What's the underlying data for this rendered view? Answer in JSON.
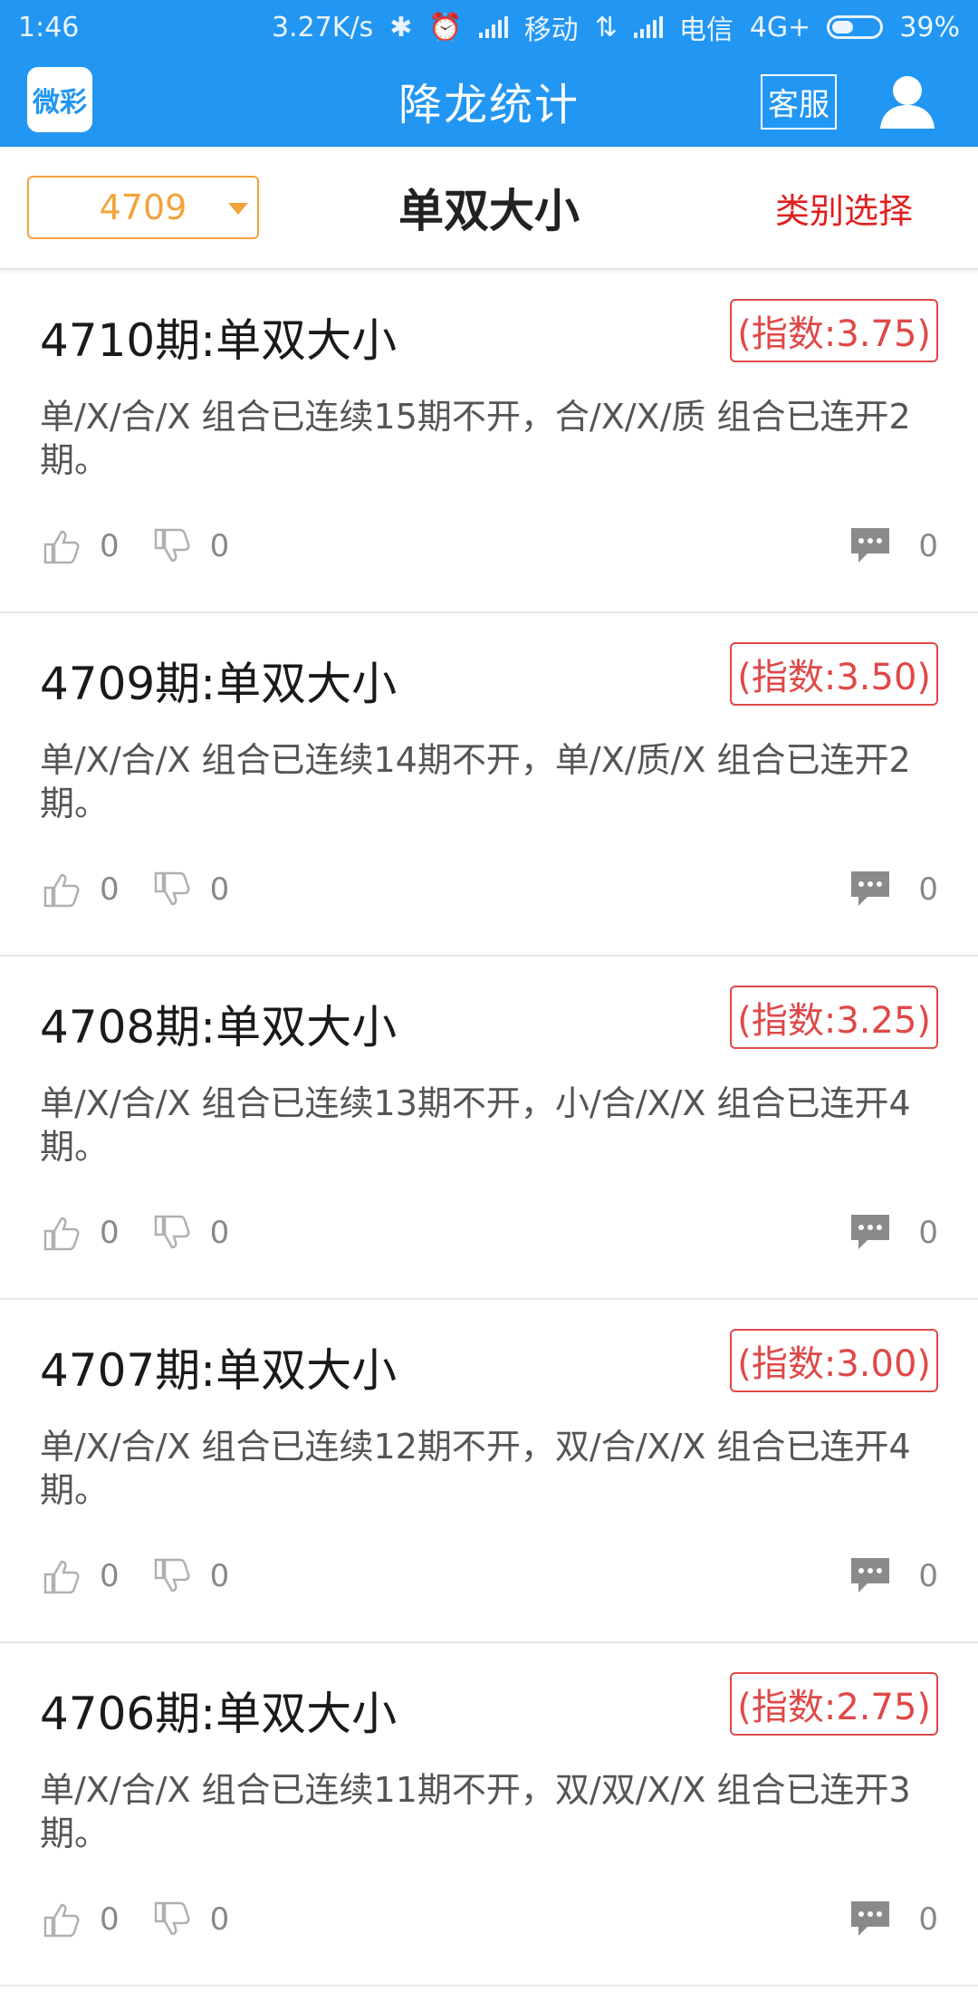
{
  "status_bar": {
    "time": "1:46",
    "speed": "3.27K/s",
    "carrier1": "移动",
    "carrier2": "电信",
    "network": "4G+",
    "battery": "39%"
  },
  "app_bar": {
    "logo_text": "微彩",
    "title": "降龙统计",
    "service_label": "客服"
  },
  "filter": {
    "period_value": "4709",
    "title": "单双大小",
    "category_label": "类别选择"
  },
  "colors": {
    "primary": "#2196f3",
    "accent_orange": "#f2a33a",
    "index_red": "#e04848",
    "category_red": "#e02020"
  },
  "items": [
    {
      "title": "4710期:单双大小",
      "index": "(指数:3.75)",
      "description": "单/X/合/X 组合已连续15期不开，合/X/X/质 组合已连开2期。",
      "likes": "0",
      "dislikes": "0",
      "comments": "0"
    },
    {
      "title": "4709期:单双大小",
      "index": "(指数:3.50)",
      "description": "单/X/合/X 组合已连续14期不开，单/X/质/X 组合已连开2期。",
      "likes": "0",
      "dislikes": "0",
      "comments": "0"
    },
    {
      "title": "4708期:单双大小",
      "index": "(指数:3.25)",
      "description": "单/X/合/X 组合已连续13期不开，小/合/X/X 组合已连开4期。",
      "likes": "0",
      "dislikes": "0",
      "comments": "0"
    },
    {
      "title": "4707期:单双大小",
      "index": "(指数:3.00)",
      "description": "单/X/合/X 组合已连续12期不开，双/合/X/X 组合已连开4期。",
      "likes": "0",
      "dislikes": "0",
      "comments": "0"
    },
    {
      "title": "4706期:单双大小",
      "index": "(指数:2.75)",
      "description": "单/X/合/X 组合已连续11期不开，双/双/X/X 组合已连开3期。",
      "likes": "0",
      "dislikes": "0",
      "comments": "0"
    }
  ]
}
